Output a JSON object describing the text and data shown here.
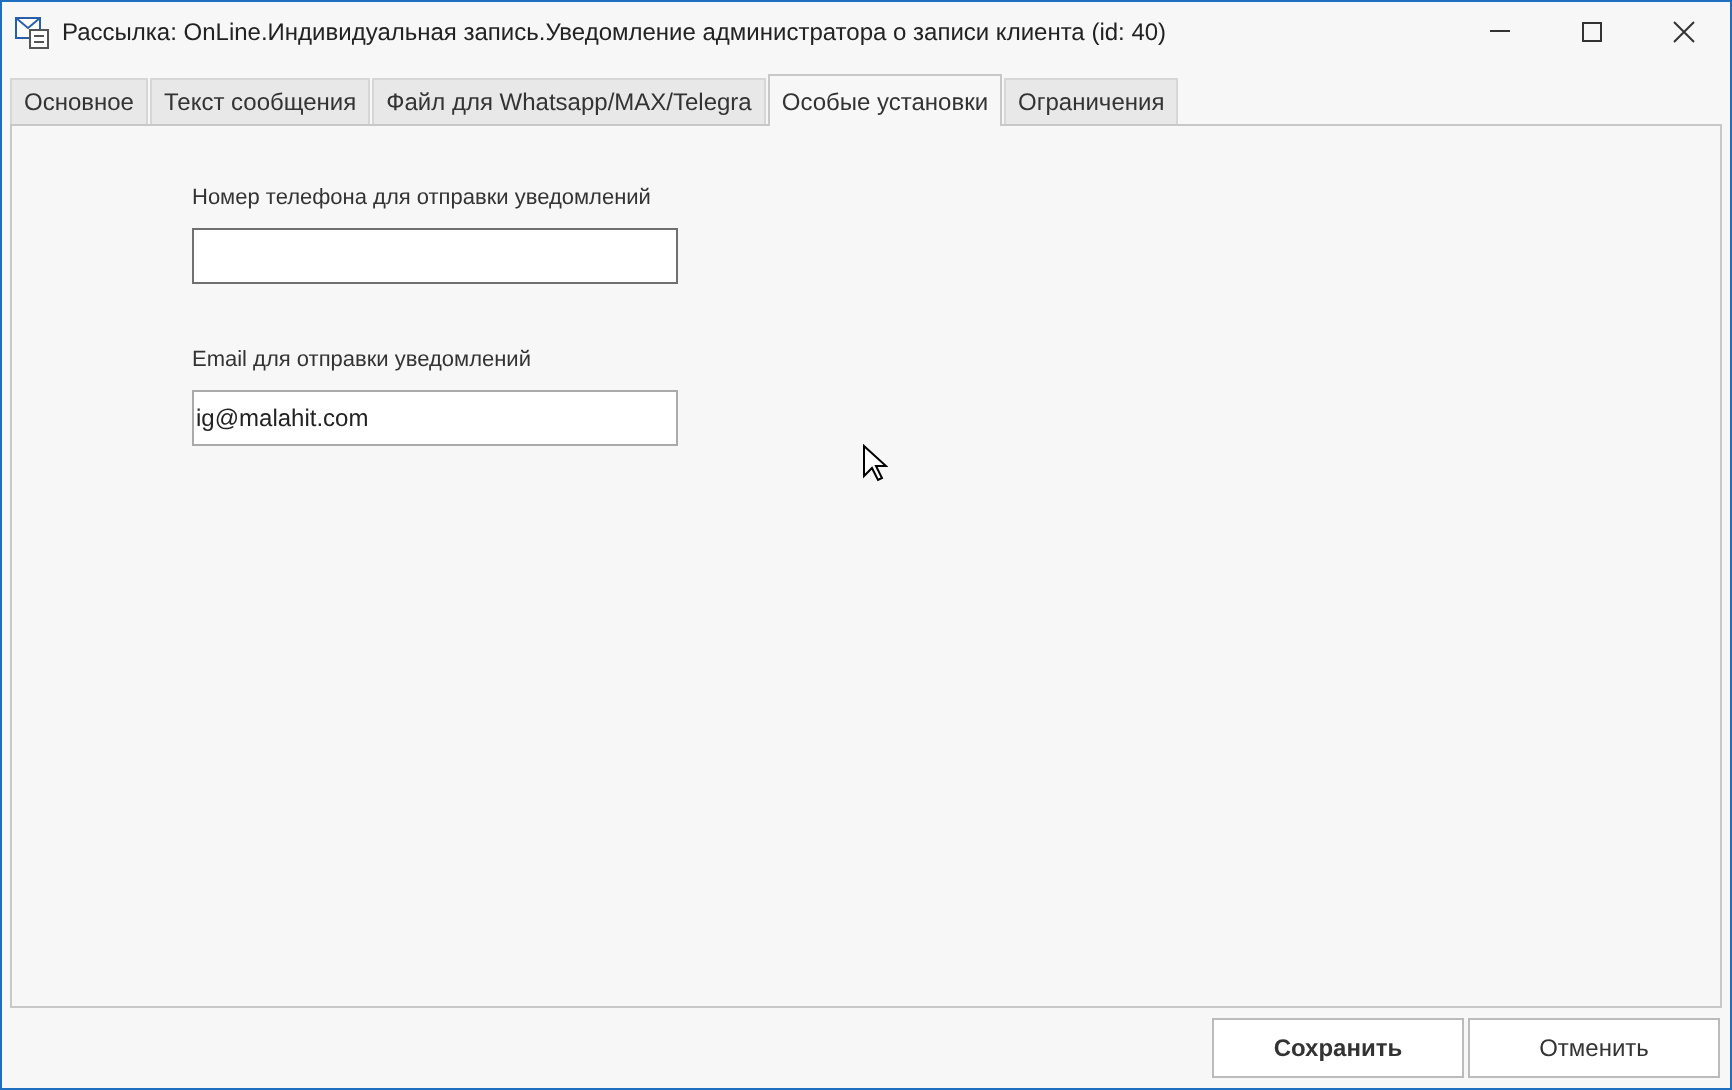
{
  "window": {
    "title": "Рассылка: OnLine.Индивидуальная запись.Уведомление администратора о записи клиента (id: 40)"
  },
  "tabs": [
    {
      "label": "Основное",
      "selected": false
    },
    {
      "label": "Текст сообщения",
      "selected": false
    },
    {
      "label": "Файл для Whatsapp/MAX/Telegra",
      "selected": false
    },
    {
      "label": "Особые установки",
      "selected": true
    },
    {
      "label": "Ограничения",
      "selected": false
    }
  ],
  "fields": [
    {
      "label": "Номер телефона для отправки уведомлений",
      "focused": true
    },
    {
      "label": "Email для отправки уведомлений",
      "value": "ig@malahit.com",
      "focused": false
    }
  ],
  "buttons": [
    {
      "label": "Сохранить",
      "default": true
    },
    {
      "label": "Отменить",
      "default": false
    }
  ]
}
